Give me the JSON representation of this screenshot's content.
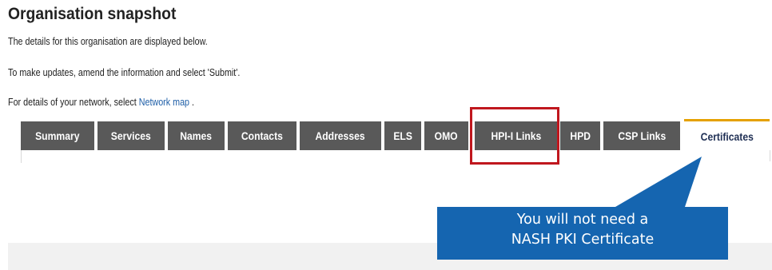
{
  "header": {
    "title": "Organisation snapshot",
    "line1": "The details for this organisation are displayed below.",
    "line2": "To make updates, amend the information and select 'Submit'.",
    "line3_prefix": "For details of your network, select ",
    "line3_link": "Network map",
    "line3_suffix": " ."
  },
  "tabs": [
    {
      "label": "Summary"
    },
    {
      "label": "Services"
    },
    {
      "label": "Names"
    },
    {
      "label": "Contacts"
    },
    {
      "label": "Addresses"
    },
    {
      "label": "ELS"
    },
    {
      "label": "OMO"
    },
    {
      "label": "HPI-I Links"
    },
    {
      "label": "HPD"
    },
    {
      "label": "CSP Links"
    },
    {
      "label": "Certificates"
    }
  ],
  "active_tab": "Certificates",
  "callout": {
    "line1": "You will not need a",
    "line2": "NASH PKI Certificate",
    "color": "#1565b0"
  },
  "colors": {
    "tab_bg": "#595959",
    "active_tab_border": "#e5a100",
    "highlight_border": "#c0171e",
    "link": "#1f5fa8"
  }
}
